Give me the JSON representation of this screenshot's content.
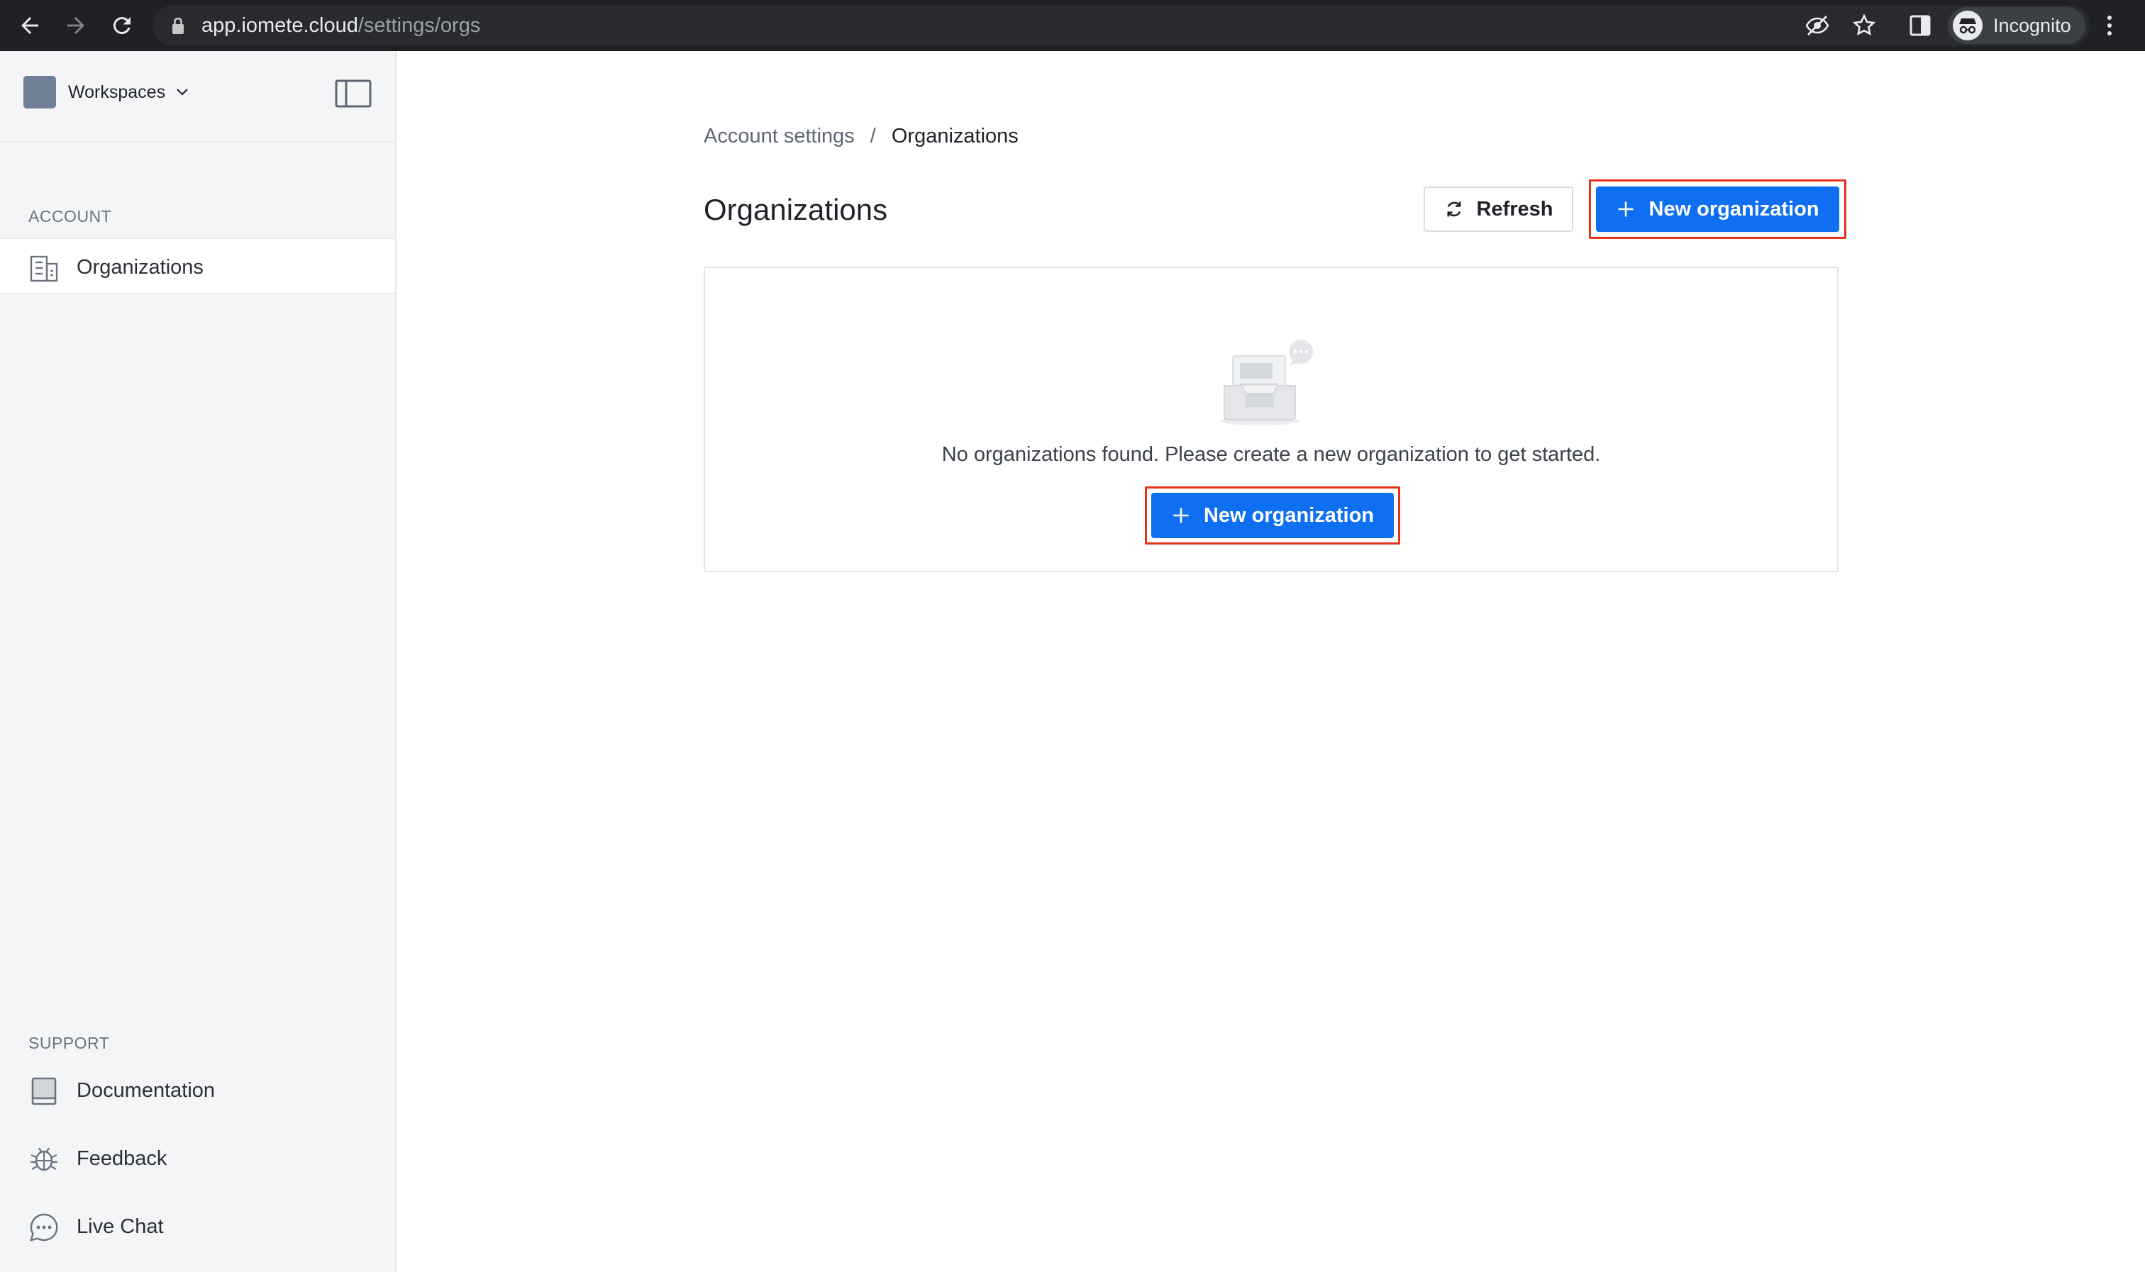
{
  "browser": {
    "url_host": "app.iomete.cloud",
    "url_path": "/settings/orgs",
    "profile_label": "Incognito"
  },
  "sidebar": {
    "workspace_label": "Workspaces",
    "account_section": "ACCOUNT",
    "account_items": [
      {
        "label": "Organizations",
        "icon": "building-icon",
        "active": true
      }
    ],
    "support_section": "SUPPORT",
    "support_items": [
      {
        "label": "Documentation",
        "icon": "book-icon"
      },
      {
        "label": "Feedback",
        "icon": "bug-icon"
      },
      {
        "label": "Live Chat",
        "icon": "chat-icon"
      }
    ]
  },
  "breadcrumb": {
    "parent": "Account settings",
    "separator": "/",
    "current": "Organizations"
  },
  "page": {
    "title": "Organizations",
    "refresh_label": "Refresh",
    "new_org_label": "New organization"
  },
  "empty_state": {
    "message": "No organizations found. Please create a new organization to get started.",
    "button_label": "New organization"
  },
  "colors": {
    "primary": "#0f6ff2",
    "highlight": "#e53219",
    "sidebar_bg": "#f4f5f7",
    "browser_bg": "#202124"
  }
}
